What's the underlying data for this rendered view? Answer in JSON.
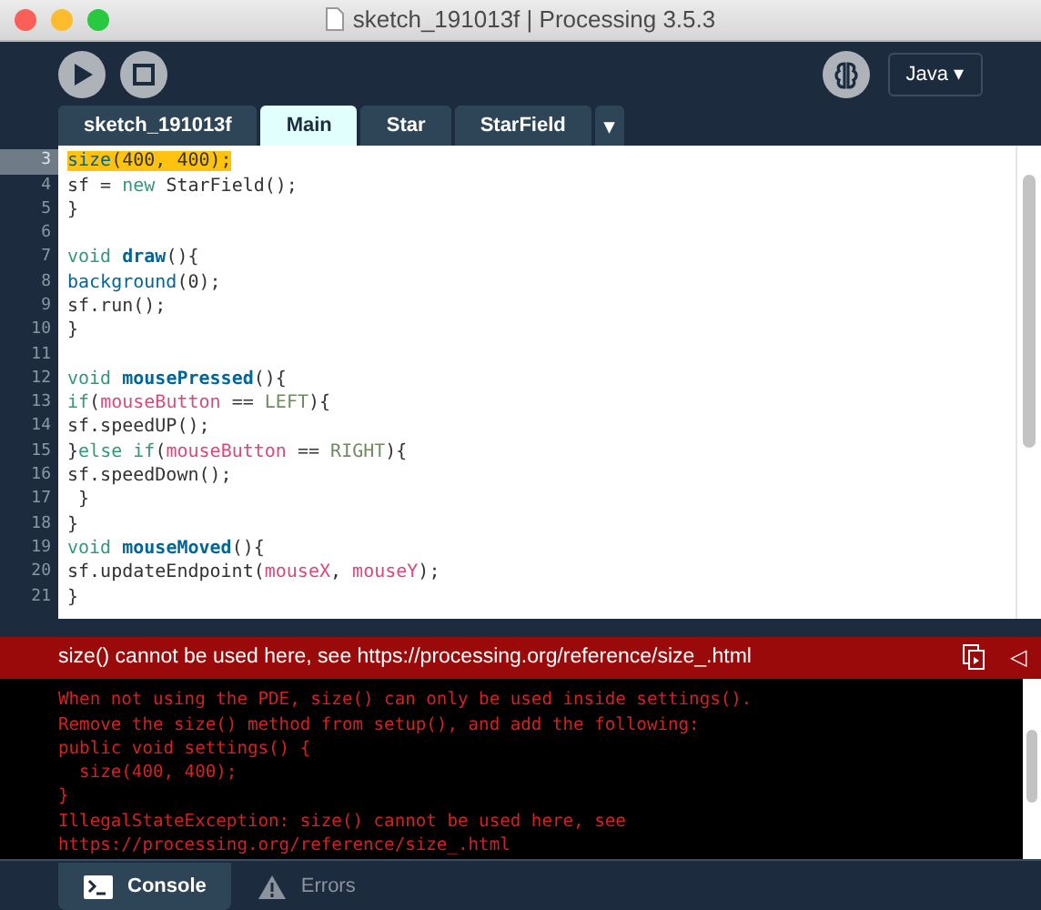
{
  "window": {
    "title": "sketch_191013f | Processing 3.5.3"
  },
  "toolbar": {
    "mode": "Java ▾"
  },
  "tabs": [
    {
      "label": "sketch_191013f",
      "selected": false
    },
    {
      "label": "Main",
      "selected": true
    },
    {
      "label": "Star",
      "selected": false
    },
    {
      "label": "StarField",
      "selected": false
    }
  ],
  "tab_menu": "▾",
  "editor": {
    "lines": [
      {
        "number": "3",
        "highlighted": true,
        "tokens": [
          {
            "text": "size",
            "kind": "builtin"
          },
          {
            "text": "(400, 400);",
            "kind": "plain"
          }
        ]
      },
      {
        "number": "4",
        "highlighted": false,
        "tokens": [
          {
            "text": "sf = ",
            "kind": "plain"
          },
          {
            "text": "new",
            "kind": "keyword"
          },
          {
            "text": " StarField();",
            "kind": "plain"
          }
        ]
      },
      {
        "number": "5",
        "highlighted": false,
        "tokens": [
          {
            "text": "}",
            "kind": "plain"
          }
        ]
      },
      {
        "number": "6",
        "highlighted": false
      },
      {
        "number": "7",
        "highlighted": false,
        "tokens": [
          {
            "text": "void ",
            "kind": "keyword"
          },
          {
            "text": "draw",
            "kind": "function"
          },
          {
            "text": "(){",
            "kind": "plain"
          }
        ]
      },
      {
        "number": "8",
        "highlighted": false,
        "tokens": [
          {
            "text": "background",
            "kind": "builtin"
          },
          {
            "text": "(0);",
            "kind": "plain"
          }
        ]
      },
      {
        "number": "9",
        "highlighted": false,
        "tokens": [
          {
            "text": "sf.run();",
            "kind": "plain"
          }
        ]
      },
      {
        "number": "10",
        "highlighted": false,
        "tokens": [
          {
            "text": "}",
            "kind": "plain"
          }
        ]
      },
      {
        "number": "11",
        "highlighted": false
      },
      {
        "number": "12",
        "highlighted": false,
        "tokens": [
          {
            "text": "void ",
            "kind": "keyword"
          },
          {
            "text": "mousePressed",
            "kind": "function"
          },
          {
            "text": "(){",
            "kind": "plain"
          }
        ]
      },
      {
        "number": "13",
        "highlighted": false,
        "tokens": [
          {
            "text": "if",
            "kind": "keyword"
          },
          {
            "text": "(",
            "kind": "plain"
          },
          {
            "text": "mouseButton",
            "kind": "variable"
          },
          {
            "text": " == ",
            "kind": "plain"
          },
          {
            "text": "LEFT",
            "kind": "constant"
          },
          {
            "text": "){",
            "kind": "plain"
          }
        ]
      },
      {
        "number": "14",
        "highlighted": false,
        "tokens": [
          {
            "text": "sf.speedUP();",
            "kind": "plain"
          }
        ]
      },
      {
        "number": "15",
        "highlighted": false,
        "tokens": [
          {
            "text": "}",
            "kind": "plain"
          },
          {
            "text": "else if",
            "kind": "keyword"
          },
          {
            "text": "(",
            "kind": "plain"
          },
          {
            "text": "mouseButton",
            "kind": "variable"
          },
          {
            "text": " == ",
            "kind": "plain"
          },
          {
            "text": "RIGHT",
            "kind": "constant"
          },
          {
            "text": "){",
            "kind": "plain"
          }
        ]
      },
      {
        "number": "16",
        "highlighted": false,
        "tokens": [
          {
            "text": "sf.speedDown();",
            "kind": "plain"
          }
        ]
      },
      {
        "number": "17",
        "highlighted": false,
        "tokens": [
          {
            "text": " }",
            "kind": "plain"
          }
        ]
      },
      {
        "number": "18",
        "highlighted": false,
        "tokens": [
          {
            "text": "}",
            "kind": "plain"
          }
        ]
      },
      {
        "number": "19",
        "highlighted": false,
        "tokens": [
          {
            "text": "void ",
            "kind": "keyword"
          },
          {
            "text": "mouseMoved",
            "kind": "function"
          },
          {
            "text": "(){",
            "kind": "plain"
          }
        ]
      },
      {
        "number": "20",
        "highlighted": false,
        "tokens": [
          {
            "text": "sf.updateEndpoint(",
            "kind": "plain"
          },
          {
            "text": "mouseX",
            "kind": "variable"
          },
          {
            "text": ", ",
            "kind": "plain"
          },
          {
            "text": "mouseY",
            "kind": "variable"
          },
          {
            "text": ");",
            "kind": "plain"
          }
        ]
      },
      {
        "number": "21",
        "highlighted": false,
        "tokens": [
          {
            "text": "}",
            "kind": "plain"
          }
        ]
      }
    ]
  },
  "error_bar": {
    "message": "size() cannot be used here, see https://processing.org/reference/size_.html",
    "collapse": "◁"
  },
  "console": {
    "lines": [
      "When not using the PDE, size() can only be used inside settings().",
      "Remove the size() method from setup(), and add the following:",
      "public void settings() {",
      "  size(400, 400);",
      "}",
      "IllegalStateException: size() cannot be used here, see",
      "https://processing.org/reference/size_.html"
    ]
  },
  "footer_tabs": [
    {
      "label": "Console",
      "kind": "console",
      "selected": true
    },
    {
      "label": "Errors",
      "kind": "errors",
      "selected": false
    }
  ]
}
